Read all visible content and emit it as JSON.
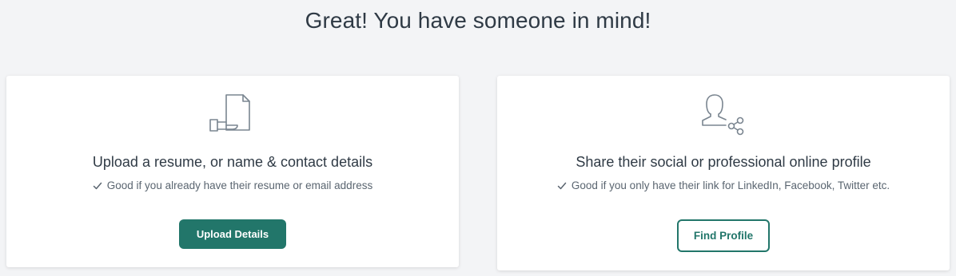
{
  "heading": "Great! You have someone in mind!",
  "colors": {
    "background": "#f3f4f6",
    "card": "#ffffff",
    "accent": "#22766a",
    "icon_stroke": "#7a8590",
    "text": "#2f3a45",
    "muted_text": "#5a6570"
  },
  "upload_card": {
    "icon": "upload-document-icon",
    "title": "Upload a resume, or name & contact details",
    "note_icon": "check-icon",
    "note": "Good if you already have their resume or email address",
    "button_label": "Upload Details"
  },
  "profile_card": {
    "icon": "share-profile-icon",
    "title": "Share their social or professional online profile",
    "note_icon": "check-icon",
    "note": "Good if you only have their link for LinkedIn, Facebook, Twitter etc.",
    "button_label": "Find Profile"
  }
}
